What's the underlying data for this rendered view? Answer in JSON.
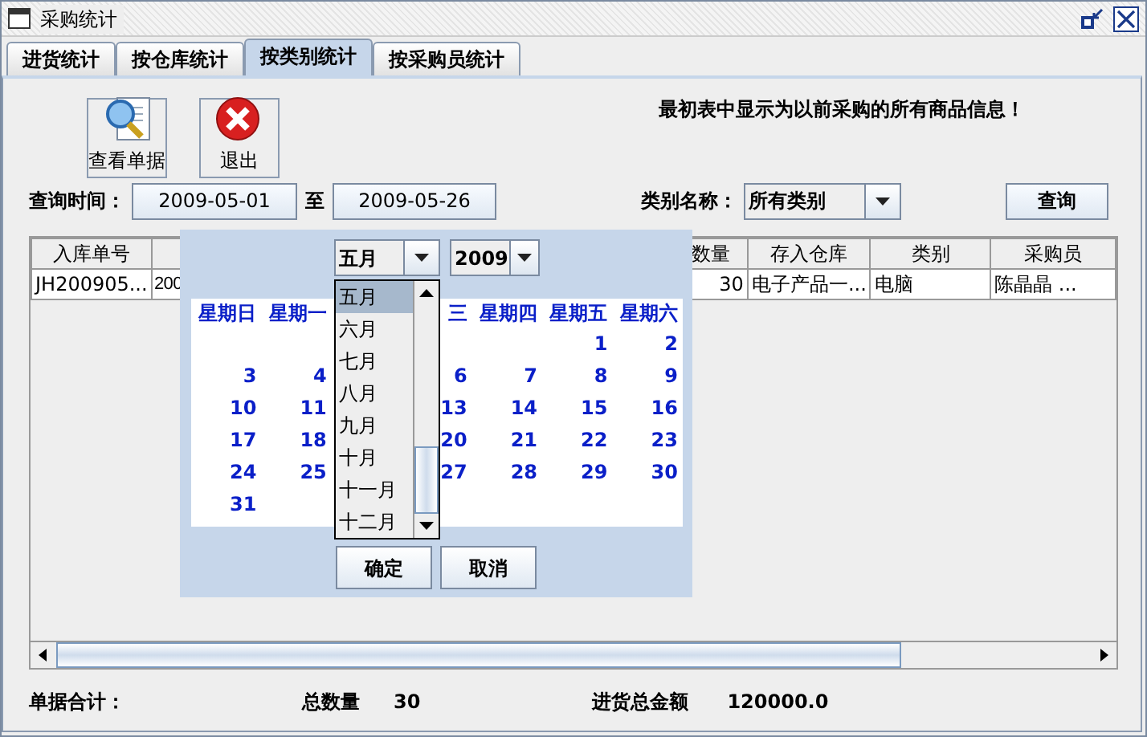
{
  "window": {
    "title": "采购统计"
  },
  "tabs": [
    {
      "label": "进货统计",
      "selected": false
    },
    {
      "label": "按仓库统计",
      "selected": false
    },
    {
      "label": "按类别统计",
      "selected": true
    },
    {
      "label": "按采购员统计",
      "selected": false
    }
  ],
  "toolbar": [
    {
      "label": "查看单据",
      "kind": "view"
    },
    {
      "label": "退出",
      "kind": "exit"
    }
  ],
  "notice": "最初表中显示为以前采购的所有商品信息！",
  "query": {
    "time_label": "查询时间：",
    "start_date": "2009-05-01",
    "to_label": "至",
    "end_date": "2009-05-26",
    "category_label": "类别名称：",
    "category": "所有类别",
    "search_button": "查询"
  },
  "table": {
    "columns": {
      "column_1": "入库单号",
      "column_3": "数量",
      "column_4": "存入仓库",
      "column_5": "类别",
      "column_6": "采购员"
    },
    "rows": [
      {
        "column_1": "JH200905...",
        "column_2": "200",
        "column_3": "30",
        "column_4": "电子产品一...",
        "column_5": "电脑",
        "column_6": "陈晶晶 ..."
      }
    ]
  },
  "date_picker": {
    "month": "五月",
    "year": "2009",
    "weekdays": {
      "sun": "星期日",
      "mon": "星期一",
      "wed": "三",
      "thu": "星期四",
      "fri": "星期五",
      "sat": "星期六"
    },
    "weeks": [
      {
        "fri": "1",
        "sat": "2"
      },
      {
        "sun": "3",
        "mon": "4",
        "wed": "6",
        "thu": "7",
        "fri": "8",
        "sat": "9"
      },
      {
        "sun": "10",
        "mon": "11",
        "wed": "13",
        "thu": "14",
        "fri": "15",
        "sat": "16"
      },
      {
        "sun": "17",
        "mon": "18",
        "wed": "20",
        "thu": "21",
        "fri": "22",
        "sat": "23"
      },
      {
        "sun": "24",
        "mon": "25",
        "wed": "27",
        "thu": "28",
        "fri": "29",
        "sat": "30"
      },
      {
        "sun": "31"
      }
    ],
    "month_options": [
      {
        "label": "五月",
        "selected": true
      },
      {
        "label": "六月",
        "selected": false
      },
      {
        "label": "七月",
        "selected": false
      },
      {
        "label": "八月",
        "selected": false
      },
      {
        "label": "九月",
        "selected": false
      },
      {
        "label": "十月",
        "selected": false
      },
      {
        "label": "十一月",
        "selected": false
      },
      {
        "label": "十二月",
        "selected": false
      }
    ],
    "ok_button": "确定",
    "cancel_button": "取消"
  },
  "summary": {
    "label": "单据合计：",
    "quantity_label": "总数量",
    "quantity": "30",
    "amount_label": "进货总金额",
    "amount": "120000.0"
  }
}
